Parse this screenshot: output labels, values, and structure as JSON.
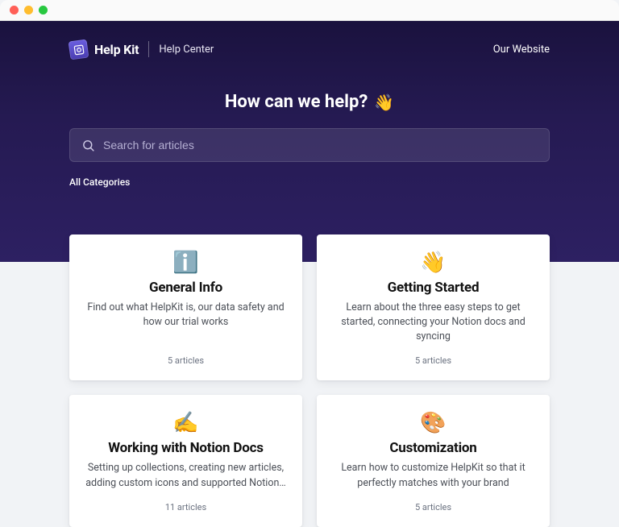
{
  "brand": "Help Kit",
  "sub_brand": "Help Center",
  "nav_link": "Our Website",
  "headline": "How can we help?",
  "headline_emoji": "👋",
  "search": {
    "placeholder": "Search for articles"
  },
  "crumb": "All Categories",
  "cards": [
    {
      "icon": "ℹ️",
      "title": "General Info",
      "desc": "Find out what HelpKit is, our data safety and how our trial works",
      "count": "5 articles"
    },
    {
      "icon": "👋",
      "title": "Getting Started",
      "desc": "Learn about the three easy steps to get started, connecting your Notion docs and syncing",
      "count": "5 articles"
    },
    {
      "icon": "✍️",
      "title": "Working with Notion Docs",
      "desc": "Setting up collections, creating new articles, adding custom icons and supported Notion…",
      "count": "11 articles"
    },
    {
      "icon": "🎨",
      "title": "Customization",
      "desc": "Learn how to customize HelpKit so that it perfectly matches with your brand",
      "count": "5 articles"
    }
  ]
}
